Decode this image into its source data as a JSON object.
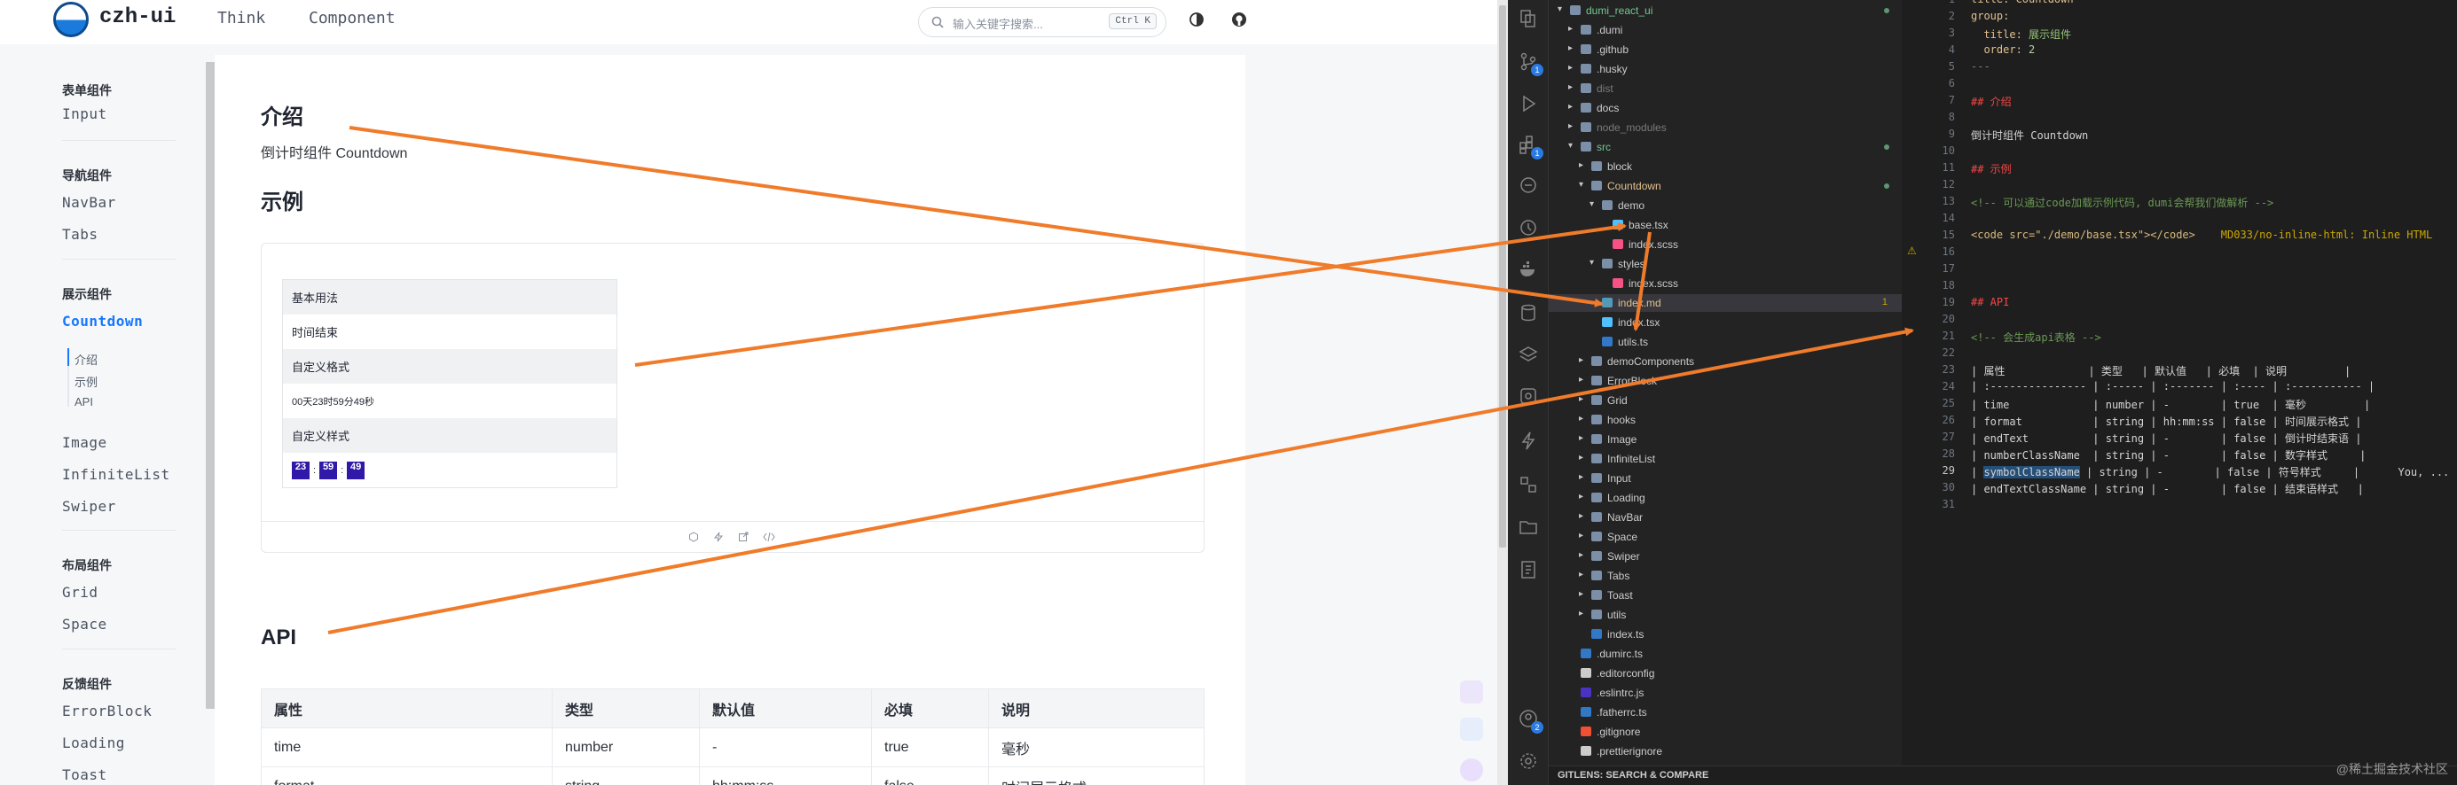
{
  "site": {
    "brand": "czh-ui",
    "nav": [
      "Think",
      "Component"
    ],
    "search": {
      "placeholder": "输入关键字搜索...",
      "shortcut": "Ctrl K"
    },
    "sidebar": {
      "groups": [
        {
          "title": "表单组件",
          "items": [
            "Input"
          ]
        },
        {
          "title": "导航组件",
          "items": [
            "NavBar",
            "Tabs"
          ]
        },
        {
          "title": "展示组件",
          "items": [
            "Countdown",
            "Image",
            "InfiniteList",
            "Swiper"
          ]
        },
        {
          "title": "布局组件",
          "items": [
            "Grid",
            "Space"
          ]
        },
        {
          "title": "反馈组件",
          "items": [
            "ErrorBlock",
            "Loading",
            "Toast"
          ]
        }
      ],
      "active": "Countdown",
      "subitems": [
        "介绍",
        "示例",
        "API"
      ]
    },
    "content": {
      "intro_heading": "介绍",
      "intro_text": "倒计时组件 Countdown",
      "example_heading": "示例",
      "demo_rows": [
        "基本用法",
        "时间结束",
        "自定义格式",
        "00天23时59分49秒",
        "自定义样式"
      ],
      "demo_chips": [
        "23",
        "59",
        "49"
      ],
      "api_heading": "API",
      "api_table": {
        "headers": [
          "属性",
          "类型",
          "默认值",
          "必填",
          "说明"
        ],
        "rows": [
          [
            "time",
            "number",
            "-",
            "true",
            "毫秒"
          ],
          [
            "format",
            "string",
            "hh:mm:ss",
            "false",
            "时间展示格式"
          ]
        ]
      }
    }
  },
  "editor": {
    "tree": [
      {
        "name": "dumi_react_ui",
        "depth": 0,
        "type": "folder-open",
        "color": "#73c991",
        "dot": true
      },
      {
        "name": ".dumi",
        "depth": 1,
        "type": "folder"
      },
      {
        "name": ".github",
        "depth": 1,
        "type": "folder"
      },
      {
        "name": ".husky",
        "depth": 1,
        "type": "folder"
      },
      {
        "name": "dist",
        "depth": 1,
        "type": "folder",
        "dim": true
      },
      {
        "name": "docs",
        "depth": 1,
        "type": "folder"
      },
      {
        "name": "node_modules",
        "depth": 1,
        "type": "folder",
        "dim": true
      },
      {
        "name": "src",
        "depth": 1,
        "type": "folder-open",
        "color": "#73c991",
        "dot": true
      },
      {
        "name": "block",
        "depth": 2,
        "type": "folder"
      },
      {
        "name": "Countdown",
        "depth": 2,
        "type": "folder-open",
        "color": "#e2c08d",
        "dot": true
      },
      {
        "name": "demo",
        "depth": 3,
        "type": "folder-open"
      },
      {
        "name": "base.tsx",
        "depth": 4,
        "type": "file",
        "icon": "#4fc1ff"
      },
      {
        "name": "index.scss",
        "depth": 4,
        "type": "file",
        "icon": "#f55385"
      },
      {
        "name": "styles",
        "depth": 3,
        "type": "folder-open"
      },
      {
        "name": "index.scss",
        "depth": 4,
        "type": "file",
        "icon": "#f55385"
      },
      {
        "name": "index.md",
        "depth": 3,
        "type": "file",
        "icon": "#519aba",
        "color": "#e2c08d",
        "sel": true,
        "count": "1"
      },
      {
        "name": "index.tsx",
        "depth": 3,
        "type": "file",
        "icon": "#4fc1ff"
      },
      {
        "name": "utils.ts",
        "depth": 3,
        "type": "file",
        "icon": "#3178c6"
      },
      {
        "name": "demoComponents",
        "depth": 2,
        "type": "folder"
      },
      {
        "name": "ErrorBlock",
        "depth": 2,
        "type": "folder"
      },
      {
        "name": "Grid",
        "depth": 2,
        "type": "folder"
      },
      {
        "name": "hooks",
        "depth": 2,
        "type": "folder"
      },
      {
        "name": "Image",
        "depth": 2,
        "type": "folder"
      },
      {
        "name": "InfiniteList",
        "depth": 2,
        "type": "folder"
      },
      {
        "name": "Input",
        "depth": 2,
        "type": "folder"
      },
      {
        "name": "Loading",
        "depth": 2,
        "type": "folder"
      },
      {
        "name": "NavBar",
        "depth": 2,
        "type": "folder"
      },
      {
        "name": "Space",
        "depth": 2,
        "type": "folder"
      },
      {
        "name": "Swiper",
        "depth": 2,
        "type": "folder"
      },
      {
        "name": "Tabs",
        "depth": 2,
        "type": "folder"
      },
      {
        "name": "Toast",
        "depth": 2,
        "type": "folder"
      },
      {
        "name": "utils",
        "depth": 2,
        "type": "folder"
      },
      {
        "name": "index.ts",
        "depth": 2,
        "type": "file",
        "icon": "#3178c6"
      },
      {
        "name": ".dumirc.ts",
        "depth": 1,
        "type": "file",
        "icon": "#3178c6"
      },
      {
        "name": ".editorconfig",
        "depth": 1,
        "type": "file",
        "icon": "#cccccc"
      },
      {
        "name": ".eslintrc.js",
        "depth": 1,
        "type": "file",
        "icon": "#4b32c3"
      },
      {
        "name": ".fatherrc.ts",
        "depth": 1,
        "type": "file",
        "icon": "#3178c6"
      },
      {
        "name": ".gitignore",
        "depth": 1,
        "type": "file",
        "icon": "#f05033"
      },
      {
        "name": ".prettierignore",
        "depth": 1,
        "type": "file",
        "icon": "#cccccc"
      }
    ],
    "statusbar": "GITLENS: SEARCH & COMPARE",
    "code": [
      {
        "n": "1",
        "segs": [
          [
            "title: Countdown",
            "#e2c08d"
          ]
        ]
      },
      {
        "n": "2",
        "segs": [
          [
            "group:",
            "#e2c08d"
          ]
        ]
      },
      {
        "n": "3",
        "segs": [
          [
            "  title: ",
            "#e2c08d"
          ],
          [
            "展示组件",
            "#98c379"
          ]
        ]
      },
      {
        "n": "4",
        "segs": [
          [
            "  order: ",
            "#e2c08d"
          ],
          [
            "2",
            "#b5cea8"
          ]
        ]
      },
      {
        "n": "5",
        "segs": [
          [
            "---",
            "#808080"
          ]
        ]
      },
      {
        "n": "6",
        "segs": []
      },
      {
        "n": "7",
        "segs": [
          [
            "## 介绍",
            "#f44747"
          ]
        ]
      },
      {
        "n": "8",
        "segs": []
      },
      {
        "n": "9",
        "segs": [
          [
            "倒计时组件 Countdown",
            "#d4d4d4"
          ]
        ]
      },
      {
        "n": "10",
        "segs": []
      },
      {
        "n": "11",
        "segs": [
          [
            "## 示例",
            "#f44747"
          ]
        ]
      },
      {
        "n": "12",
        "segs": []
      },
      {
        "n": "13",
        "segs": [
          [
            "<!-- 可以通过code加载示例代码, dumi会帮我们做解析 -->",
            "#6a9955"
          ]
        ]
      },
      {
        "n": "14",
        "segs": []
      },
      {
        "n": "15",
        "segs": [
          [
            "<code src=\"./demo/base.tsx\"></code>",
            "#d7ba7d"
          ],
          [
            "    MD033/no-inline-html: Inline HTML",
            "#cca700"
          ]
        ]
      },
      {
        "n": "16",
        "segs": []
      },
      {
        "n": "17",
        "segs": []
      },
      {
        "n": "18",
        "segs": []
      },
      {
        "n": "19",
        "segs": [
          [
            "## API",
            "#f44747"
          ]
        ]
      },
      {
        "n": "20",
        "segs": []
      },
      {
        "n": "21",
        "segs": [
          [
            "<!-- 会生成api表格 -->",
            "#6a9955"
          ]
        ]
      },
      {
        "n": "22",
        "segs": []
      },
      {
        "n": "23",
        "segs": [
          [
            "| 属性             | 类型   | 默认值   | 必填  | 说明         |",
            "#d4d4d4"
          ]
        ]
      },
      {
        "n": "24",
        "segs": [
          [
            "| :--------------- | :----- | :------- | :---- | :----------- |",
            "#d4d4d4"
          ]
        ]
      },
      {
        "n": "25",
        "segs": [
          [
            "| time             | number | -        | true  | 毫秒         |",
            "#d4d4d4"
          ]
        ]
      },
      {
        "n": "26",
        "segs": [
          [
            "| format           | string | hh:mm:ss | false | 时间展示格式 |",
            "#d4d4d4"
          ]
        ]
      },
      {
        "n": "27",
        "segs": [
          [
            "| endText          | string | -        | false | 倒计时结束语 |",
            "#d4d4d4"
          ]
        ]
      },
      {
        "n": "28",
        "segs": [
          [
            "| numberClassName  | string | -        | false | 数字样式     |",
            "#d4d4d4"
          ]
        ]
      },
      {
        "n": "29",
        "segs": [
          [
            "| ",
            "#d4d4d4"
          ],
          [
            "symbolClassName",
            "#d4d4d4"
          ],
          [
            " | string | -        | false | 符号样式     |      You, ...",
            "#d4d4d4"
          ]
        ]
      },
      {
        "n": "30",
        "segs": [
          [
            "| endTextClassName | string | -        | false | 结束语样式   |",
            "#d4d4d4"
          ]
        ]
      },
      {
        "n": "31",
        "segs": []
      }
    ],
    "current_line": "29",
    "watermark": "@稀土掘金技术社区"
  },
  "accent": "#f07b2a",
  "link_color": "#1677ff"
}
